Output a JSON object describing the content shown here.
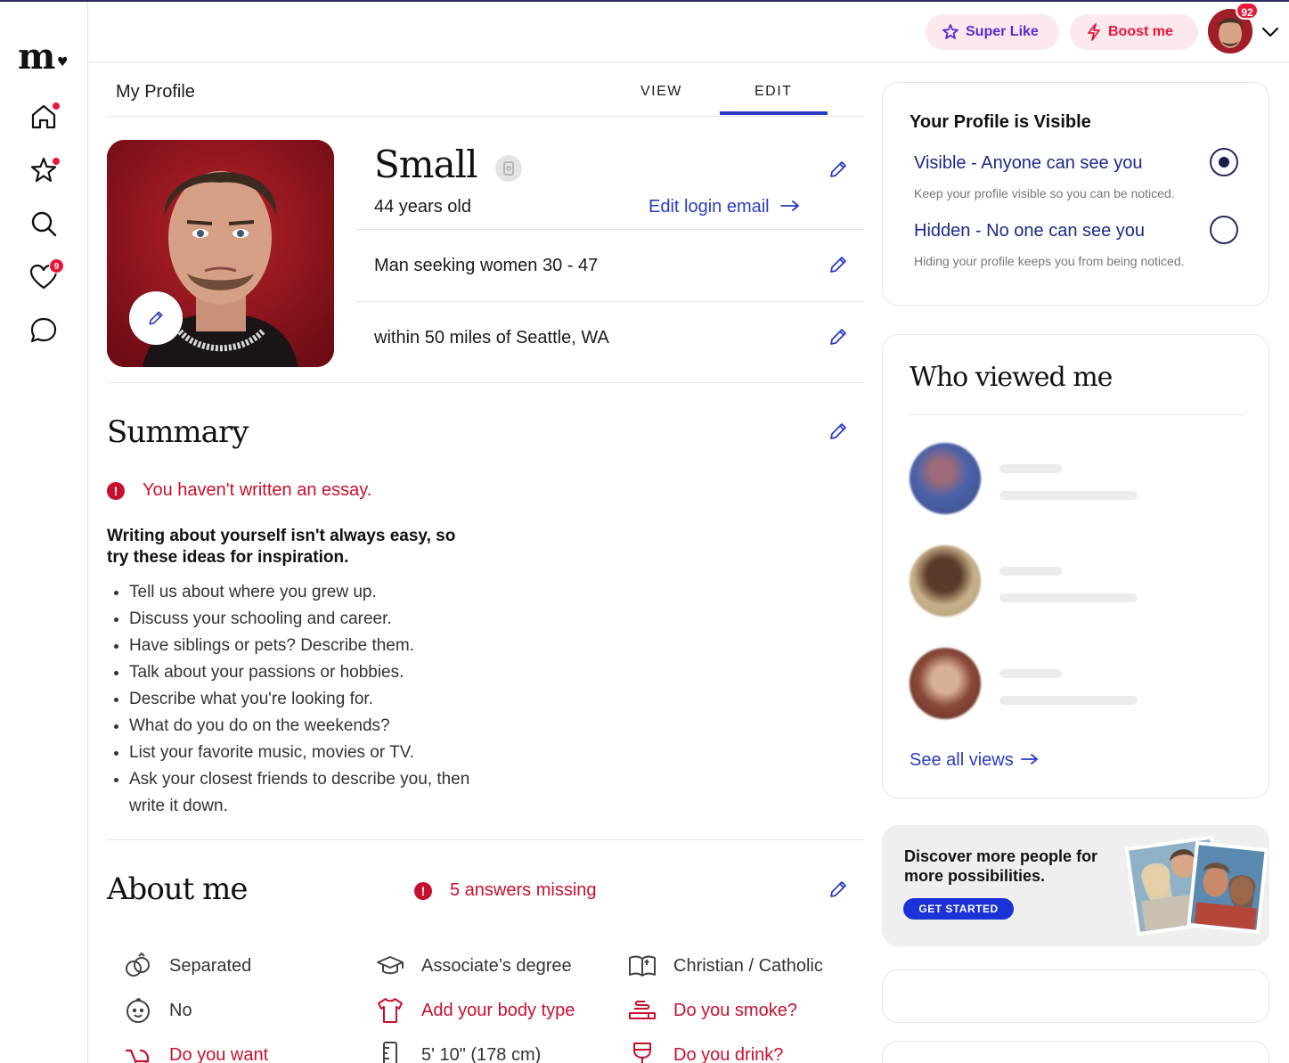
{
  "brand": {
    "logo_text": "m",
    "logo_mark": "♥"
  },
  "nav": {
    "items": [
      {
        "icon": "home-icon",
        "has_dot": true
      },
      {
        "icon": "star-icon",
        "has_dot": true
      },
      {
        "icon": "search-icon",
        "has_dot": false
      },
      {
        "icon": "heart-icon",
        "badge": "9"
      },
      {
        "icon": "chat-icon",
        "has_dot": false
      }
    ],
    "likes_badge": "9"
  },
  "header": {
    "super_like_label": "Super Like",
    "boost_label": "Boost me",
    "notification_count": "92"
  },
  "profile_tabs": {
    "title": "My Profile",
    "view_label": "VIEW",
    "edit_label": "EDIT",
    "active": "EDIT"
  },
  "profile": {
    "name": "Small",
    "age_text": "44 years old",
    "edit_login_email": "Edit login email",
    "seeking": "Man seeking women 30 - 47",
    "location": "within 50 miles of Seattle, WA"
  },
  "summary": {
    "heading": "Summary",
    "warning": "You haven't written an essay.",
    "inspiration_title": "Writing about yourself isn't always easy, so try these ideas for inspiration.",
    "tips": [
      "Tell us about where you grew up.",
      "Discuss your schooling and career.",
      "Have siblings or pets? Describe them.",
      "Talk about your passions or hobbies.",
      "Describe what you're looking for.",
      "What do you do on the weekends?",
      "List your favorite music, movies or TV.",
      "Ask your closest friends to describe you, then write it down."
    ]
  },
  "about": {
    "heading": "About me",
    "missing": "5 answers missing",
    "items": [
      {
        "icon": "rings-icon",
        "text": "Separated",
        "missing": false
      },
      {
        "icon": "graduation-cap-icon",
        "text": "Associate’s degree",
        "missing": false
      },
      {
        "icon": "book-icon",
        "text": "Christian / Catholic",
        "missing": false
      },
      {
        "icon": "baby-face-icon",
        "text": "No",
        "missing": false
      },
      {
        "icon": "shirt-icon",
        "text": "Add your body type",
        "missing": true
      },
      {
        "icon": "cigarette-icon",
        "text": "Do you smoke?",
        "missing": true
      },
      {
        "icon": "stroller-icon",
        "text": "Do you want",
        "missing": true
      },
      {
        "icon": "ruler-icon",
        "text": "5' 10\" (178 cm)",
        "missing": false
      },
      {
        "icon": "wine-glass-icon",
        "text": "Do you drink?",
        "missing": true
      }
    ]
  },
  "visibility": {
    "title": "Your Profile is Visible",
    "visible_label": "Visible - Anyone can see you",
    "visible_sub": "Keep your profile visible so you can be noticed.",
    "hidden_label": "Hidden - No one can see you",
    "hidden_sub": "Hiding your profile keeps you from being noticed.",
    "selected": "visible"
  },
  "who_viewed": {
    "title": "Who viewed me",
    "see_all": "See all views"
  },
  "promo": {
    "text": "Discover more people for more possibilities.",
    "button": "GET STARTED"
  },
  "colors": {
    "accent_blue": "#2a3cc4",
    "alert_red": "#c8102e",
    "badge_red": "#e8173a",
    "pill_bg": "#fde8ee",
    "super_like_purple": "#5b2ad1"
  }
}
